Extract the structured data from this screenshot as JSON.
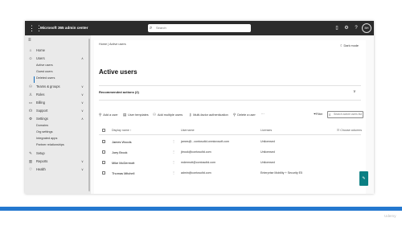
{
  "topbar": {
    "app_title": "Microsoft 365 admin center",
    "search_placeholder": "Search",
    "avatar_initials": "BH",
    "icons": [
      "waffle-icon",
      "search-icon",
      "mobile-icon",
      "settings-icon",
      "help-icon"
    ]
  },
  "sidebar": {
    "items": [
      {
        "label": "Home",
        "icon": "home-icon"
      },
      {
        "label": "Users",
        "icon": "user-icon",
        "expanded": true,
        "children": [
          "Active users",
          "Guest users",
          "Deleted users"
        ]
      },
      {
        "label": "Teams & groups",
        "icon": "teams-icon"
      },
      {
        "label": "Roles",
        "icon": "roles-icon"
      },
      {
        "label": "Billing",
        "icon": "billing-icon"
      },
      {
        "label": "Support",
        "icon": "support-icon"
      },
      {
        "label": "Settings",
        "icon": "settings-icon",
        "expanded": true,
        "children": [
          "Domains",
          "Org settings",
          "Integrated apps",
          "Partner relationships"
        ]
      },
      {
        "label": "Setup",
        "icon": "setup-icon"
      },
      {
        "label": "Reports",
        "icon": "reports-icon"
      },
      {
        "label": "Health",
        "icon": "health-icon"
      }
    ],
    "active_child": "Active users"
  },
  "main": {
    "breadcrumb": "Home  |  Active users",
    "dark_mode": "Dark mode",
    "title": "Active users",
    "recommended": "Recommended actions (2)",
    "commands": [
      {
        "label": "Add a user",
        "icon": "add-user-icon"
      },
      {
        "label": "User templates",
        "icon": "template-icon"
      },
      {
        "label": "Add multiple users",
        "icon": "add-multiple-icon"
      },
      {
        "label": "Multi-factor authentication",
        "icon": "key-icon"
      },
      {
        "label": "Delete a user",
        "icon": "delete-user-icon"
      },
      {
        "label": "···",
        "icon": ""
      }
    ],
    "filter_label": "Filter",
    "search_placeholder": "Search active users list",
    "table": {
      "headers": [
        "Display name ↑",
        "Username",
        "Licenses",
        "Choose columns"
      ],
      "rows": [
        {
          "name": "James Woods",
          "username": "james@...contosoltd.onmicrosoft.com",
          "licenses": "Unlicensed"
        },
        {
          "name": "Joey Brook",
          "username": "jbrook@contosoltd.com",
          "licenses": "Unlicensed"
        },
        {
          "name": "Mike McDermott",
          "username": "mdermott@contosoltd.com",
          "licenses": "Unlicensed"
        },
        {
          "name": "Thomas Mitchell",
          "username": "admin@contosoltd.com",
          "licenses": "Enterprise Mobility + Security E5"
        }
      ]
    }
  },
  "feedback_icon": "feedback-icon",
  "watermark": "Udemy",
  "colors": {
    "topbar": "#2b2b2b",
    "sidebar": "#eaeaea",
    "accent": "#2478cf",
    "feedback": "#0b7f83"
  }
}
